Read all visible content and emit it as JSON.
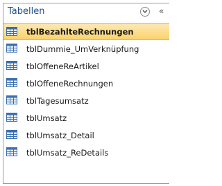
{
  "nav_pane": {
    "title": "Tabellen",
    "collapse_glyph": "«",
    "chevron_icon": "chevron-down-icon",
    "table_icon": "table-icon",
    "colors": {
      "selection": "#fbd36b",
      "title": "#1e4e8a"
    },
    "items": [
      {
        "label": "tblBezahlteRechnungen",
        "selected": true
      },
      {
        "label": "tblDummie_UmVerknüpfung"
      },
      {
        "label": "tblOffeneReArtikel"
      },
      {
        "label": "tblOffeneRechnungen"
      },
      {
        "label": "tblTagesumsatz"
      },
      {
        "label": "tblUmsatz"
      },
      {
        "label": "tblUmsatz_Detail"
      },
      {
        "label": "tblUmsatz_ReDetails"
      }
    ]
  }
}
